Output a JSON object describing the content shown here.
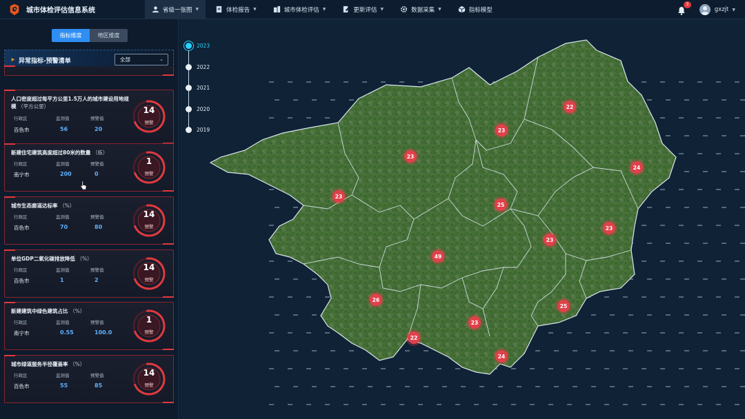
{
  "app": {
    "title": "城市体检评估信息系统"
  },
  "nav": [
    {
      "label": "省级一张图",
      "icon": "user-icon",
      "active": true
    },
    {
      "label": "体检报告",
      "icon": "report-icon",
      "active": false
    },
    {
      "label": "城市体检评估",
      "icon": "building-icon",
      "active": false
    },
    {
      "label": "更新评估",
      "icon": "edit-doc-icon",
      "active": false
    },
    {
      "label": "数据采集",
      "icon": "gear-icon",
      "active": false
    },
    {
      "label": "指标模型",
      "icon": "cube-icon",
      "active": false
    }
  ],
  "user": {
    "notifications": "3",
    "name": "gxzjt"
  },
  "panel": {
    "toggle_on": "指标维度",
    "toggle_off": "地区维度",
    "list_title": "异常指标-预警清单",
    "filter_value": "全部",
    "col_region": "行政区",
    "col_monitor": "监测值",
    "col_warn": "预警值",
    "warn_label": "预警",
    "cards": [
      {
        "title": "人口密度超过每平方公里1.5万人的城市建设用地规模",
        "unit": "（平方公里）",
        "region": "百色市",
        "monitor": "56",
        "warn": "20",
        "count": "14"
      },
      {
        "title": "新建住宅建筑高度超过80米的数量",
        "unit": "（栋）",
        "region": "南宁市",
        "monitor": "200",
        "warn": "0",
        "count": "1"
      },
      {
        "title": "城市生态廊道达标率",
        "unit": "（%）",
        "region": "百色市",
        "monitor": "70",
        "warn": "80",
        "count": "14"
      },
      {
        "title": "单位GDP二氧化碳排放降低",
        "unit": "（%）",
        "region": "百色市",
        "monitor": "1",
        "warn": "2",
        "count": "14"
      },
      {
        "title": "新建建筑中绿色建筑占比",
        "unit": "（%）",
        "region": "南宁市",
        "monitor": "0.55",
        "warn": "100.0",
        "count": "1"
      },
      {
        "title": "城市绿道服务半径覆盖率",
        "unit": "（%）",
        "region": "百色市",
        "monitor": "55",
        "warn": "85",
        "count": "14"
      }
    ]
  },
  "timeline": [
    {
      "year": "2023",
      "active": true
    },
    {
      "year": "2022",
      "active": false
    },
    {
      "year": "2021",
      "active": false
    },
    {
      "year": "2020",
      "active": false
    },
    {
      "year": "2019",
      "active": false
    }
  ],
  "markers": [
    "22",
    "23",
    "23",
    "24",
    "23",
    "25",
    "23",
    "23",
    "49",
    "26",
    "25",
    "23",
    "22",
    "24"
  ],
  "colors": {
    "accent": "#2f8ef2",
    "warn": "#e0414a",
    "timeline_active": "#2ad3ff"
  }
}
